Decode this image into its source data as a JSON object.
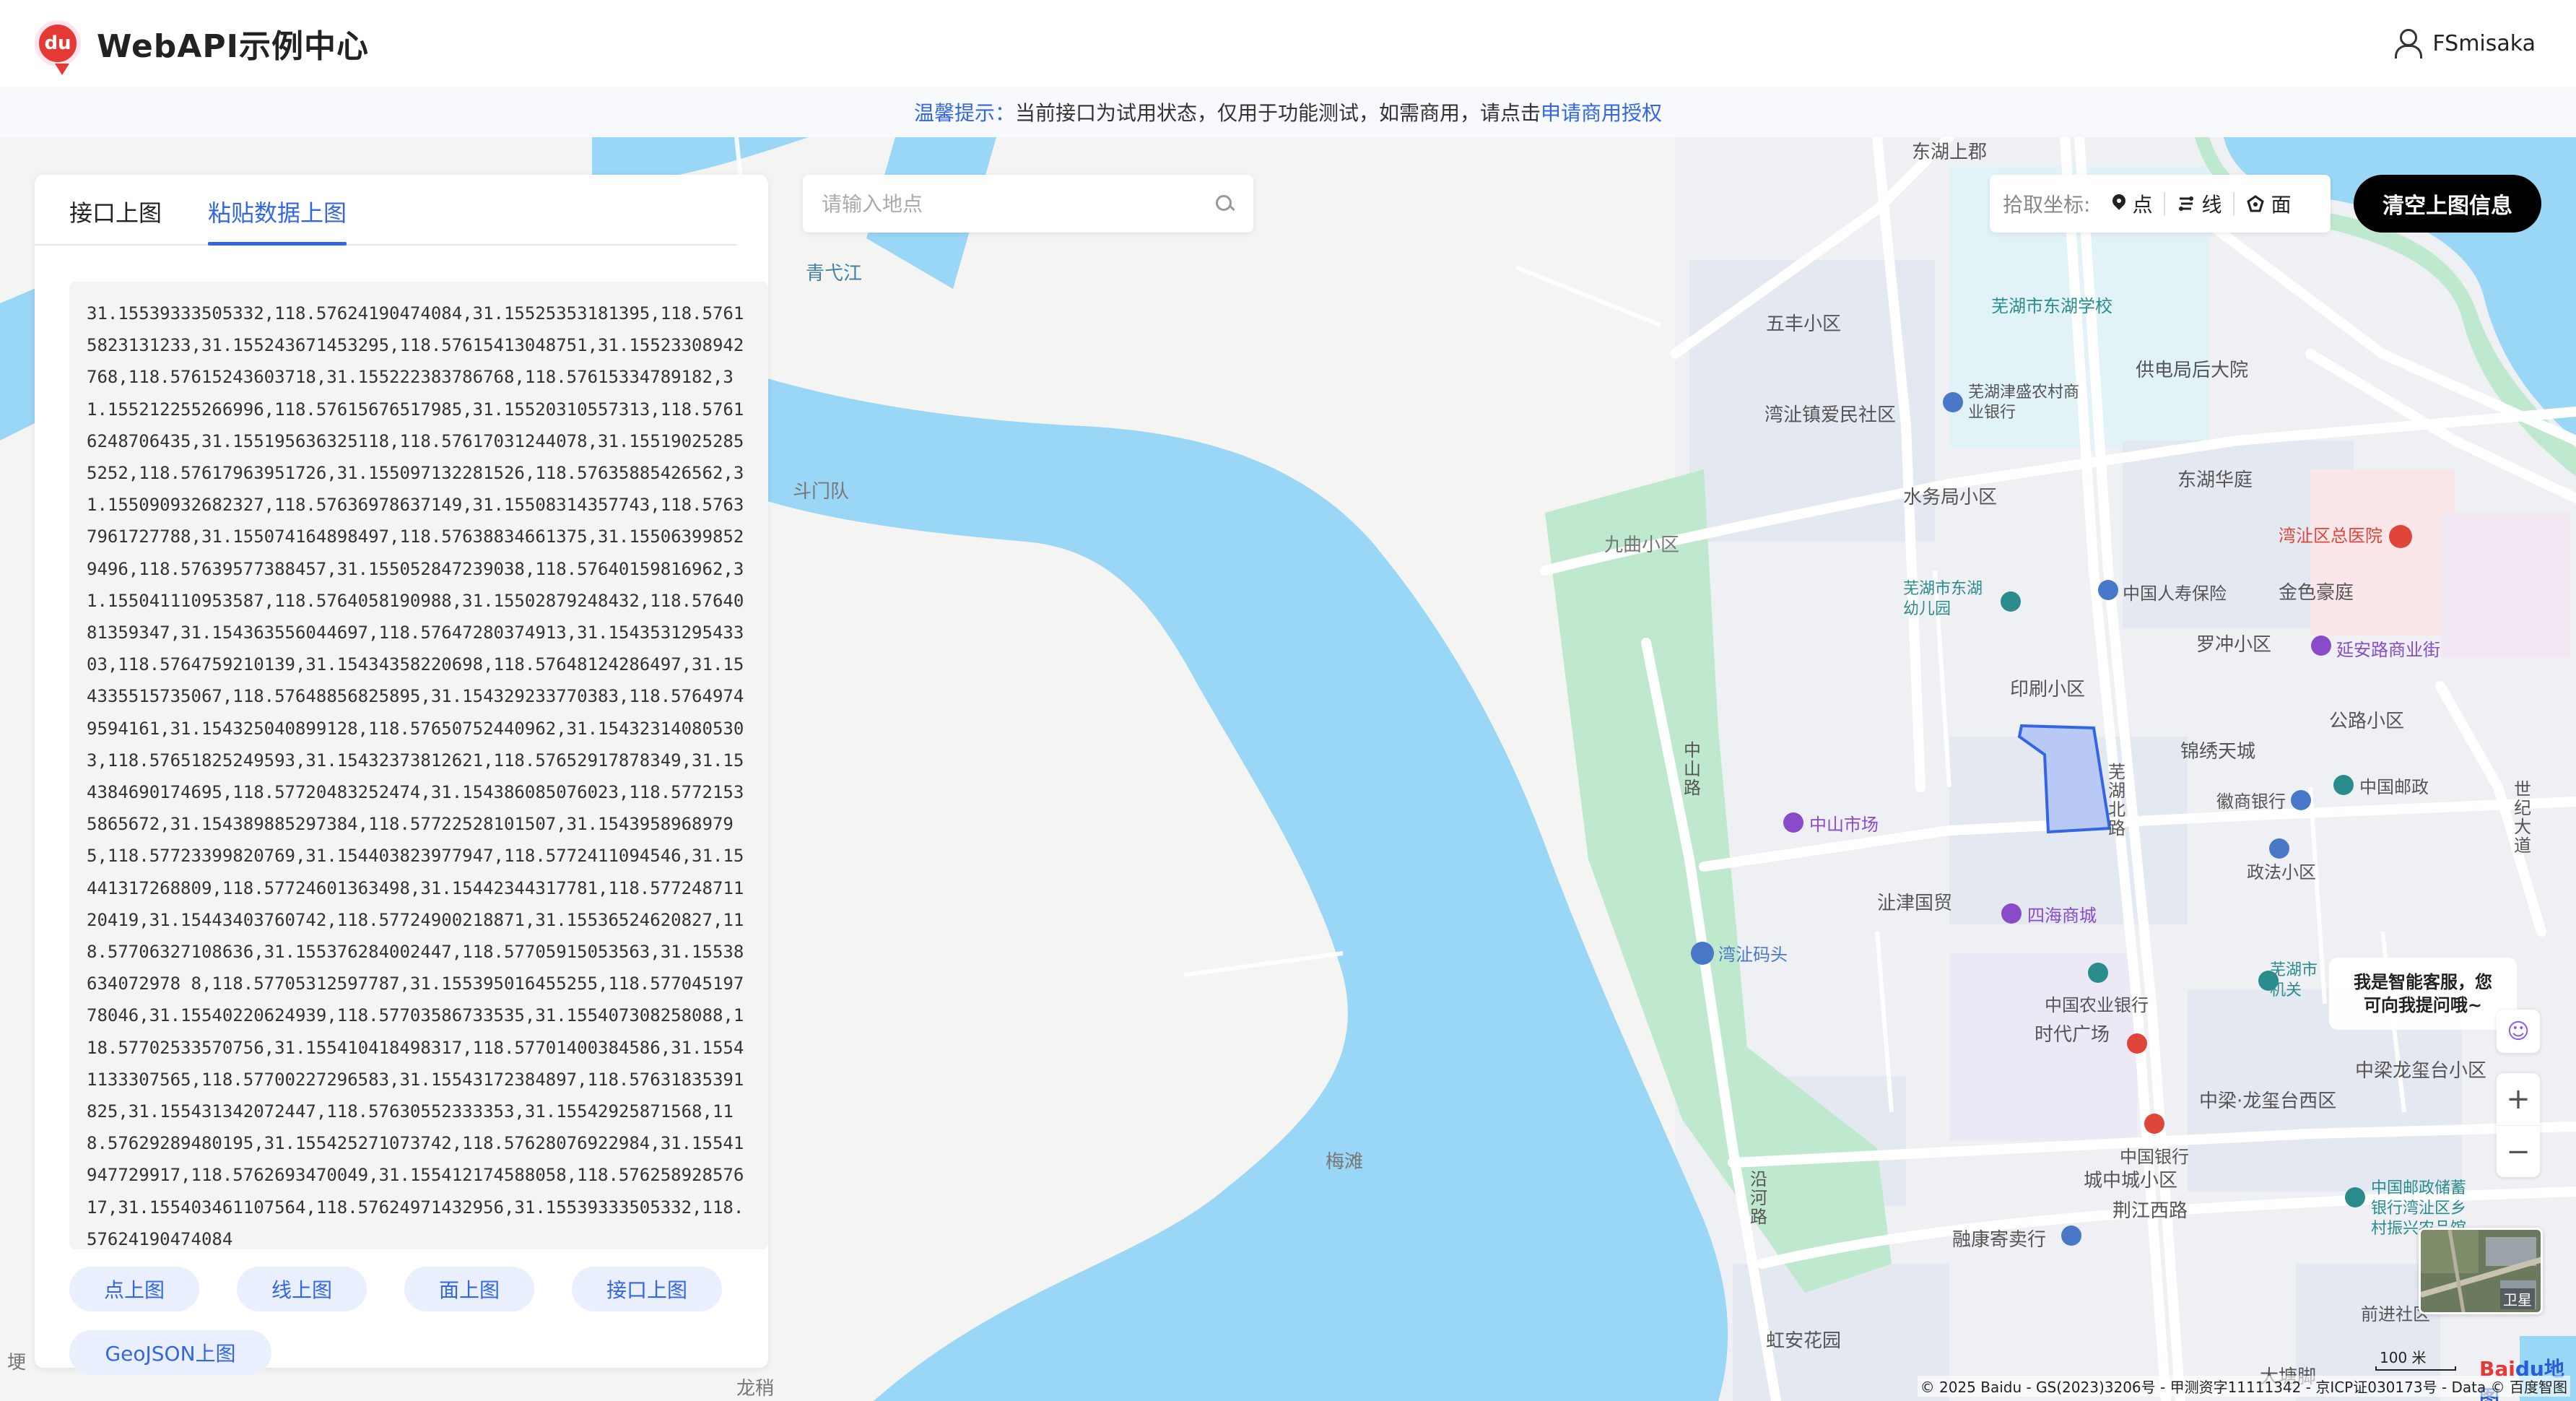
{
  "header": {
    "logo_text": "du",
    "brand": "WebAPI示例中心",
    "username": "FSmisaka"
  },
  "notice": {
    "prefix": "温馨提示：",
    "text": "当前接口为试用状态，仅用于功能测试，如需商用，请点击",
    "link": "申请商用授权"
  },
  "panel": {
    "tabs": [
      {
        "label": "接口上图",
        "active": false
      },
      {
        "label": "粘贴数据上图",
        "active": true
      }
    ],
    "coordinates": "31.15539333505332,118.57624190474084,31.15525353181395,118.57615823131233,31.155243671453295,118.57615413048751,31.15523308942768,118.57615243603718,31.155222383786768,118.57615334789182,31.155212255266996,118.57615676517985,31.15520310557313,118.57616248706435,31.155195636325118,118.57617031244078,31.155190252855252,118.57617963951726,31.155097132281526,118.57635885426562,31.155090932682327,118.57636978637149,31.15508314357743,118.57637961727788,31.155074164898497,118.57638834661375,31.155063998529496,118.57639577388457,31.155052847239038,118.57640159816962,31.155041110953587,118.5764058190988,31.15502879248432,118.5764081359347,31.154363556044697,118.57647280374913,31.154353129543303,118.5764759210139,31.15434358220698,118.57648124286497,31.154335515735067,118.57648856825895,31.154329233770383,118.57649749594161,31.154325040899128,118.57650752440962,31.154323140805303,118.57651825249593,31.15432373812621,118.57652917878349,31.154384690174695,118.57720483252474,31.154386085076023,118.57721535865672,31.154389885297384,118.57722528101507,31.15439589689795,118.57723399820769,31.154403823977947,118.5772411094546,31.15441317268809,118.57724601363498,31.15442344317781,118.57724871120419,31.15443403760742,118.57724900218871,31.15536524620827,118.57706327108636,31.155376284002447,118.57705915053563,31.15538634072978 8,118.57705312597787,31.155395016455255,118.57704519778046,31.15540220624939,118.57703586733535,31.155407308258088,118.57702533570756,31.155410418498317,118.57701400384586,31.15541133307565,118.57700227296583,31.15543172384897,118.57631835391825,31.155431342072447,118.57630552333353,31.15542925871568,118.57629289480195,31.155425271073742,118.57628076922984,31.15541947729917,118.5762693470049,31.155412174588058,118.57625892857617,31.155403461107564,118.57624971432956,31.15539333505332,118.57624190474084",
    "buttons": [
      "点上图",
      "线上图",
      "面上图",
      "接口上图"
    ],
    "geojson_button": "GeoJSON上图"
  },
  "search": {
    "placeholder": "请输入地点"
  },
  "pick_toolbar": {
    "label": "拾取坐标:",
    "point": "点",
    "line": "线",
    "polygon": "面"
  },
  "clear_button": "清空上图信息",
  "ai_tip": {
    "line1": "我是智能客服，您",
    "line2": "可向我提问哦~"
  },
  "map_labels": [
    "青弋江",
    "斗门队",
    "梅滩",
    "龙稍",
    "埂",
    "东湖上郡",
    "芜湖市东湖学校",
    "五丰小区",
    "供电局后大院",
    "芜湖津盛农村商业银行",
    "湾沚镇爱民社区",
    "东湖华庭",
    "水务局小区",
    "九曲小区",
    "湾沚区总医院",
    "芜湖市东湖幼儿园",
    "中国人寿保险",
    "金色豪庭",
    "罗冲小区",
    "延安路商业街",
    "印刷小区",
    "公路小区",
    "锦绣天城",
    "芜湖北路",
    "中国邮政",
    "徽商银行",
    "世纪大道",
    "中山路",
    "中山市场",
    "政法小区",
    "沚津国贸",
    "四海商城",
    "湾沚码头",
    "中国农业银行",
    "时代广场",
    "中梁龙玺台小区",
    "中梁·龙玺台西区",
    "中国银行",
    "城中城小区",
    "中国邮政储蓄银行湾沚区乡村振兴农品馆",
    "荆江西路",
    "融康寄卖行",
    "沿河路",
    "虹安花园",
    "前进社区",
    "大塘脚",
    "芜湖市机关"
  ],
  "map_controls": {
    "ai_icon": "chat-bot-icon",
    "zoom_in": "+",
    "zoom_out": "−",
    "satellite_label": "卫星",
    "scale": "100 米",
    "baidu_logo_a": "Bai",
    "baidu_logo_b": "du地图"
  },
  "copyright": "© 2025 Baidu - GS(2023)3206号 - 甲测资字11111342 - 京ICP证030173号 - Data © 百度智图",
  "colors": {
    "accent": "#3366e6",
    "water": "#9ad6f5",
    "green": "#bfe9cf",
    "polygon_fill": "#b8c9f5",
    "polygon_stroke": "#3366e6"
  }
}
